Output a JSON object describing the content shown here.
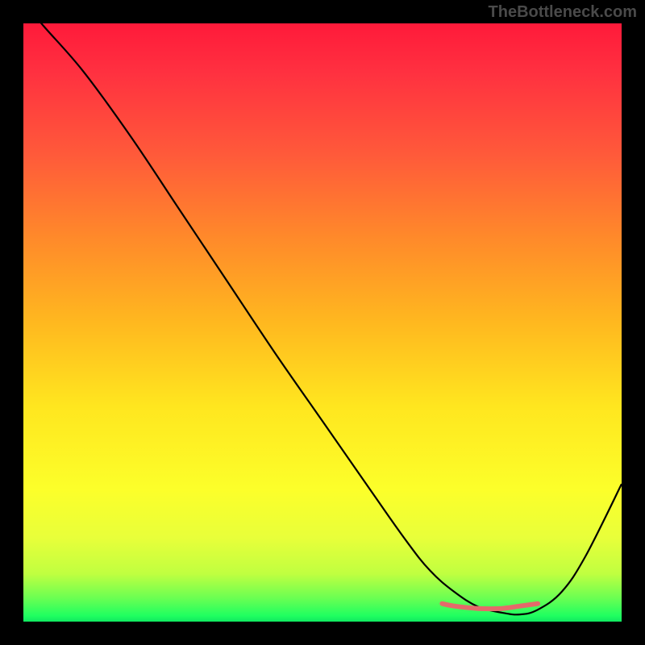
{
  "watermark": "TheBottleneck.com",
  "chart_data": {
    "type": "line",
    "title": "",
    "xlabel": "",
    "ylabel": "",
    "xlim": [
      0,
      100
    ],
    "ylim": [
      0,
      100
    ],
    "x": [
      0,
      3,
      10,
      18,
      26,
      34,
      42,
      50,
      58,
      64,
      68,
      72,
      76,
      80,
      83,
      86,
      90,
      94,
      100
    ],
    "values": [
      104,
      100,
      92,
      81,
      69,
      57,
      45,
      33.5,
      22,
      13.5,
      8.5,
      5,
      2.5,
      1.5,
      1.2,
      2,
      5,
      11,
      23
    ],
    "note": "x and y are normalized 0-100 over the visible plot area; values above 100 indicate the curve starts above the top of the plot region. A short salmon overlay segment sits near the trough between x≈70 and x≈86 at y≈2.5.",
    "overlay_segment": {
      "x": [
        70,
        72,
        76,
        80,
        83,
        86
      ],
      "values": [
        3,
        2.6,
        2.2,
        2.2,
        2.6,
        3
      ],
      "color": "#e46a6a"
    },
    "background_gradient": {
      "stops": [
        {
          "pos": 0.0,
          "color": "#ff1a3a"
        },
        {
          "pos": 0.22,
          "color": "#ff5a3a"
        },
        {
          "pos": 0.5,
          "color": "#ffb81f"
        },
        {
          "pos": 0.78,
          "color": "#fcff2a"
        },
        {
          "pos": 0.96,
          "color": "#6cff52"
        },
        {
          "pos": 1.0,
          "color": "#10e860"
        }
      ]
    }
  }
}
